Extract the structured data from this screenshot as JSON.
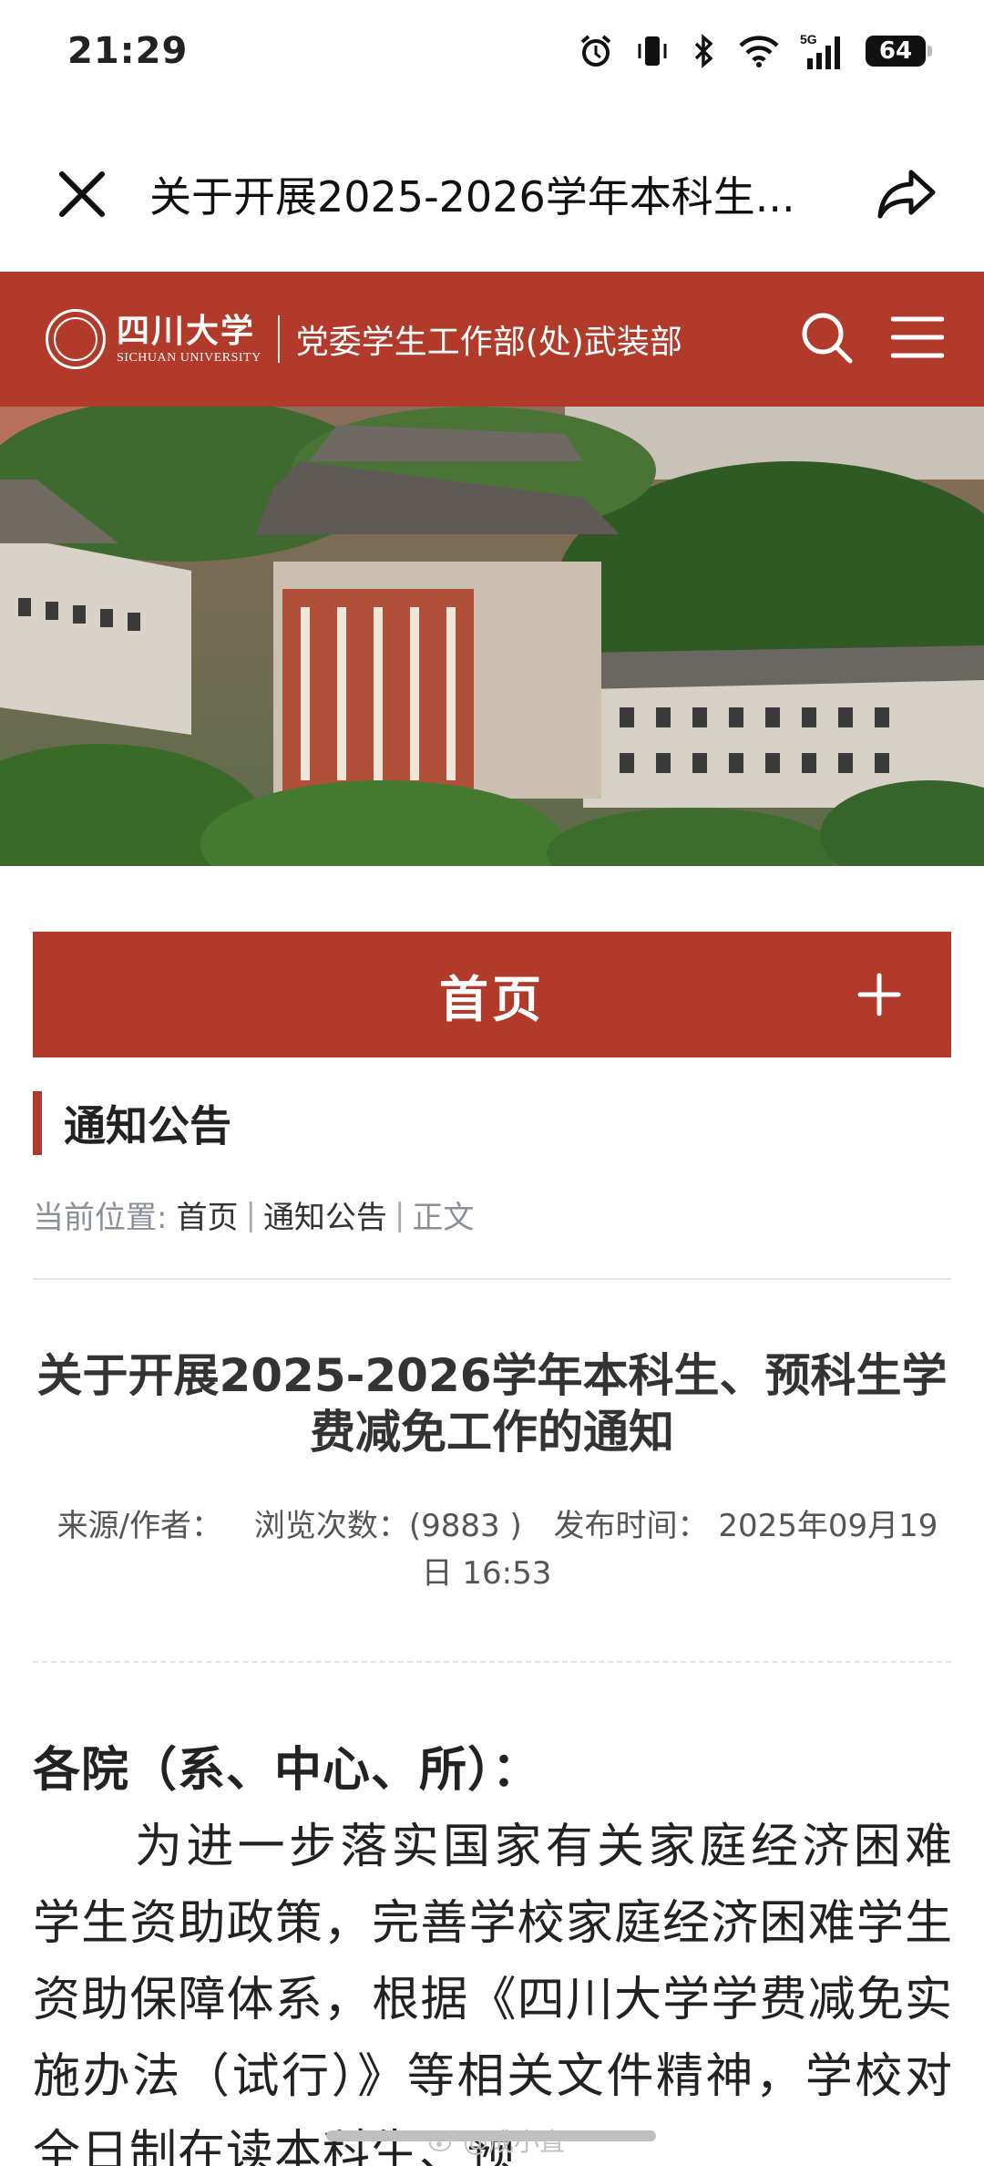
{
  "status_bar": {
    "time": "21:29",
    "network": "5G",
    "battery": "64"
  },
  "webview": {
    "title": "关于开展2025-2026学年本科生..."
  },
  "site": {
    "logo_cn": "四川大学",
    "logo_en": "SICHUAN UNIVERSITY",
    "department": "党委学生工作部(处)武装部",
    "brand_color": "#b23a2b"
  },
  "nav": {
    "home_label": "首页"
  },
  "section": {
    "heading": "通知公告"
  },
  "breadcrumb": {
    "prefix": "当前位置:",
    "items": [
      "首页",
      "通知公告",
      "正文"
    ]
  },
  "article": {
    "title": "关于开展2025-2026学年本科生、预科生学费减免工作的通知",
    "meta": {
      "source": "来源/作者：",
      "views": "浏览次数：(9883 )",
      "published": "发布时间：  2025年09月19日 16:53"
    },
    "salutation": "各院（系、中心、所）：",
    "paragraph": "为进一步落实国家有关家庭经济困难学生资助政策，完善学校家庭经济困难学生资助保障体系，根据《四川大学学费减免实施办法（试行）》等相关文件精神，学校对全日制在读本科生、预"
  },
  "watermark": "@成小直"
}
